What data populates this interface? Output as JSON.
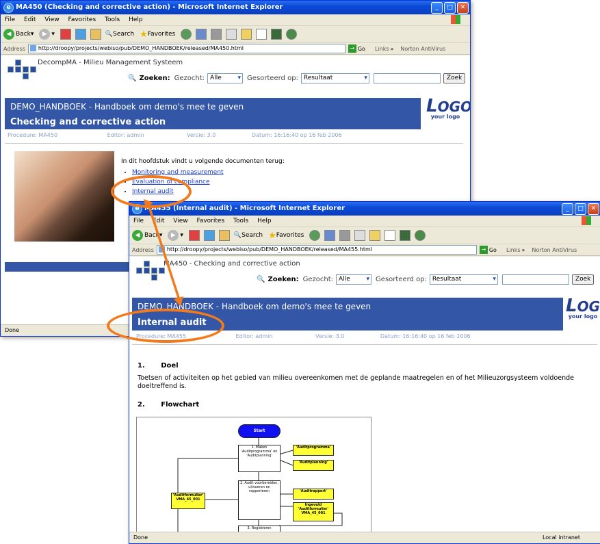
{
  "window1": {
    "title": "MA450 (Checking and corrective action) - Microsoft Internet Explorer",
    "menu": [
      "File",
      "Edit",
      "View",
      "Favorites",
      "Tools",
      "Help"
    ],
    "toolbar": {
      "back": "Back",
      "search": "Search",
      "favorites": "Favorites"
    },
    "address_label": "Address",
    "address": "http://droopy/projects/webiso/pub/DEMO_HANDBOEK/released/MA450.html",
    "go": "Go",
    "links": "Links",
    "norton": "Norton AntiVirus",
    "breadcrumb": "DecompMA - Milieu Management Systeem",
    "search": {
      "label": "Zoeken:",
      "gezocht_label": "Gezocht:",
      "gezocht_value": "Alle",
      "gesorteerd_label": "Gesorteerd op:",
      "gesorteerd_value": "Resultaat",
      "button": "Zoek"
    },
    "banner_title": "DEMO_HANDBOEK - Handboek om demo's mee te geven",
    "banner_subtitle": "Checking and corrective action",
    "logo_big": "OGO",
    "logo_small": "your logo",
    "meta": {
      "procedure": "Procedure: MA450",
      "editor": "Editor: admin",
      "versie": "Versie: 3.0",
      "datum": "Datum: 16:16:40 op 16 feb 2006"
    },
    "intro": "In dit hoofdstuk vindt u volgende documenten terug:",
    "links_list": [
      "Monitoring and measurement",
      "Evaluation of compliance",
      "Internal audit"
    ],
    "status": "Done"
  },
  "window2": {
    "title": "MA455 (Internal audit) - Microsoft Internet Explorer",
    "menu": [
      "File",
      "Edit",
      "View",
      "Favorites",
      "Tools",
      "Help"
    ],
    "toolbar": {
      "back": "Back",
      "search": "Search",
      "favorites": "Favorites"
    },
    "address_label": "Address",
    "address": "http://droopy/projects/webiso/pub/DEMO_HANDBOEK/released/MA455.html",
    "go": "Go",
    "links": "Links",
    "norton": "Norton AntiVirus",
    "breadcrumb": "MA450 - Checking and corrective action",
    "search": {
      "label": "Zoeken:",
      "gezocht_label": "Gezocht:",
      "gezocht_value": "Alle",
      "gesorteerd_label": "Gesorteerd op:",
      "gesorteerd_value": "Resultaat",
      "button": "Zoek"
    },
    "banner_title": "DEMO_HANDBOEK - Handboek om demo's mee te geven",
    "banner_subtitle": "Internal audit",
    "logo_big": "OGO",
    "logo_small": "your logo",
    "meta": {
      "procedure": "Procedure: MA455",
      "editor": "Editor: admin",
      "versie": "Versie: 3.0",
      "datum": "Datum: 16:16:40 op 16 feb 2006"
    },
    "section1_num": "1.",
    "section1_title": "Doel",
    "section1_text": "Toetsen of activiteiten op het gebied van milieu overeenkomen met de geplande maatregelen en of het Milieuzorgsysteem voldoende doeltreffend is.",
    "section2_num": "2.",
    "section2_title": "Flowchart",
    "flow": {
      "start": "Start",
      "step1": "1. Maken 'Auditprogramma' en 'Auditplanning'",
      "doc1": "'Auditprogramma'",
      "doc2": "'Auditplanning'",
      "step2": "2. Audit voorbereiden, uitvoeren en rapporteren",
      "doc3": "'Auditformulier' VMA_45_001",
      "doc4": "'Auditrapport'",
      "doc5": "Ingevuld 'Auditformulier' VMA_45_001",
      "step3": "3. Registreren"
    },
    "status": "Done",
    "status_zone": "Local intranet"
  },
  "colors": {
    "banner": "#3357a6",
    "highlight": "#f07a1c",
    "link": "#1a3bd6"
  }
}
